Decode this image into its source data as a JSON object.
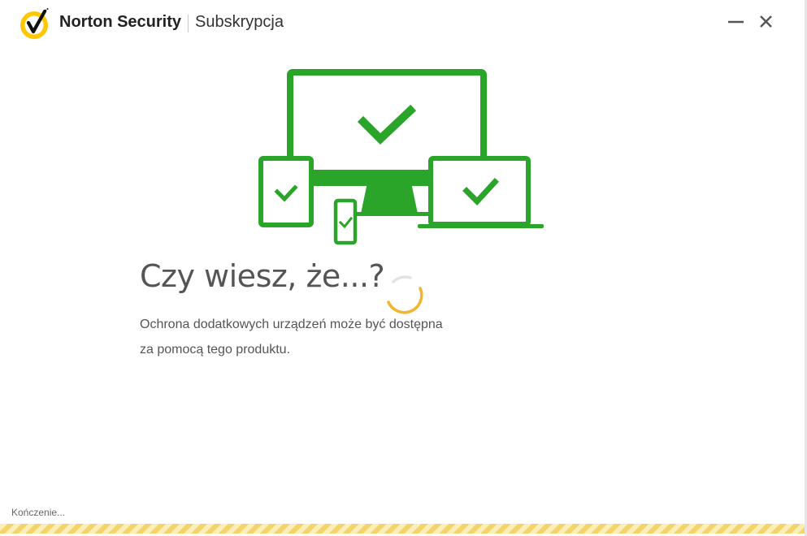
{
  "app": {
    "brand": "Norton Security",
    "section": "Subskrypcja"
  },
  "tip": {
    "heading": "Czy wiesz, że...?",
    "body_line1": "Ochrona dodatkowych urządzeń może być dostępna",
    "body_line2": "za pomocą tego produktu."
  },
  "status": {
    "text": "Kończenie...",
    "progress_indeterminate": true
  },
  "icons": {
    "logo": "norton-checkmark-logo-icon",
    "minimize": "minimize-icon",
    "close": "close-icon",
    "illustration": "devices-protected-illustration",
    "spinner": "loading-spinner-icon"
  },
  "colors": {
    "accent_green": "#2aa52a",
    "norton_yellow": "#ffc700",
    "spinner_yellow": "#f2b531",
    "text_gray": "#555555"
  }
}
